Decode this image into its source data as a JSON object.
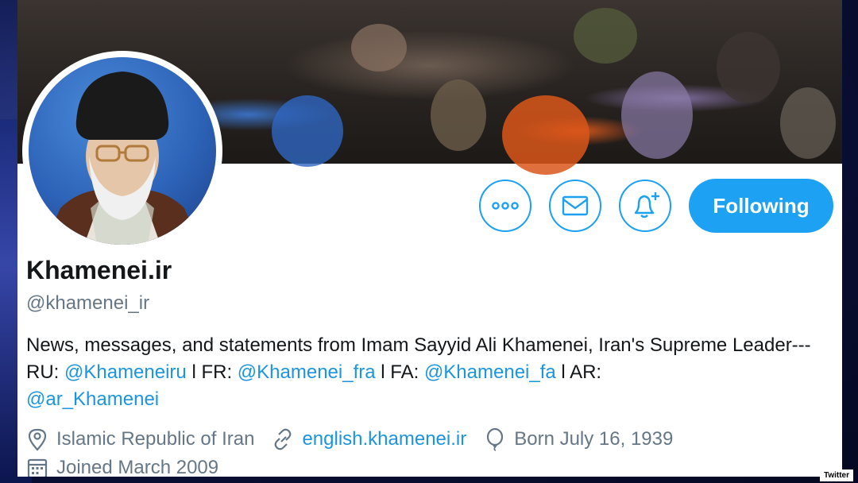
{
  "profile": {
    "name": "Khamenei.ir",
    "handle": "@khamenei_ir",
    "bio": {
      "text_1": "News, messages, and statements from Imam Sayyid Ali Khamenei, Iran's Supreme Leader--- RU: ",
      "link_ru": "@Khameneiru",
      "sep_fr": " l FR: ",
      "link_fr": "@Khamenei_fra",
      "sep_fa": " l FA: ",
      "link_fa": "@Khamenei_fa",
      "sep_ar": " l AR: ",
      "link_ar": "@ar_Khamenei"
    },
    "location": "Islamic Republic of Iran",
    "website": "english.khamenei.ir",
    "born": "Born July 16, 1939",
    "joined": "Joined March 2009"
  },
  "actions": {
    "more_icon": "more-icon",
    "message_icon": "envelope-icon",
    "notify_icon": "bell-plus-icon",
    "follow_label": "Following"
  },
  "watermark": "Twitter",
  "colors": {
    "accent": "#1da1f2",
    "link": "#1b95e0",
    "secondary_text": "#657786",
    "primary_text": "#14171a"
  }
}
